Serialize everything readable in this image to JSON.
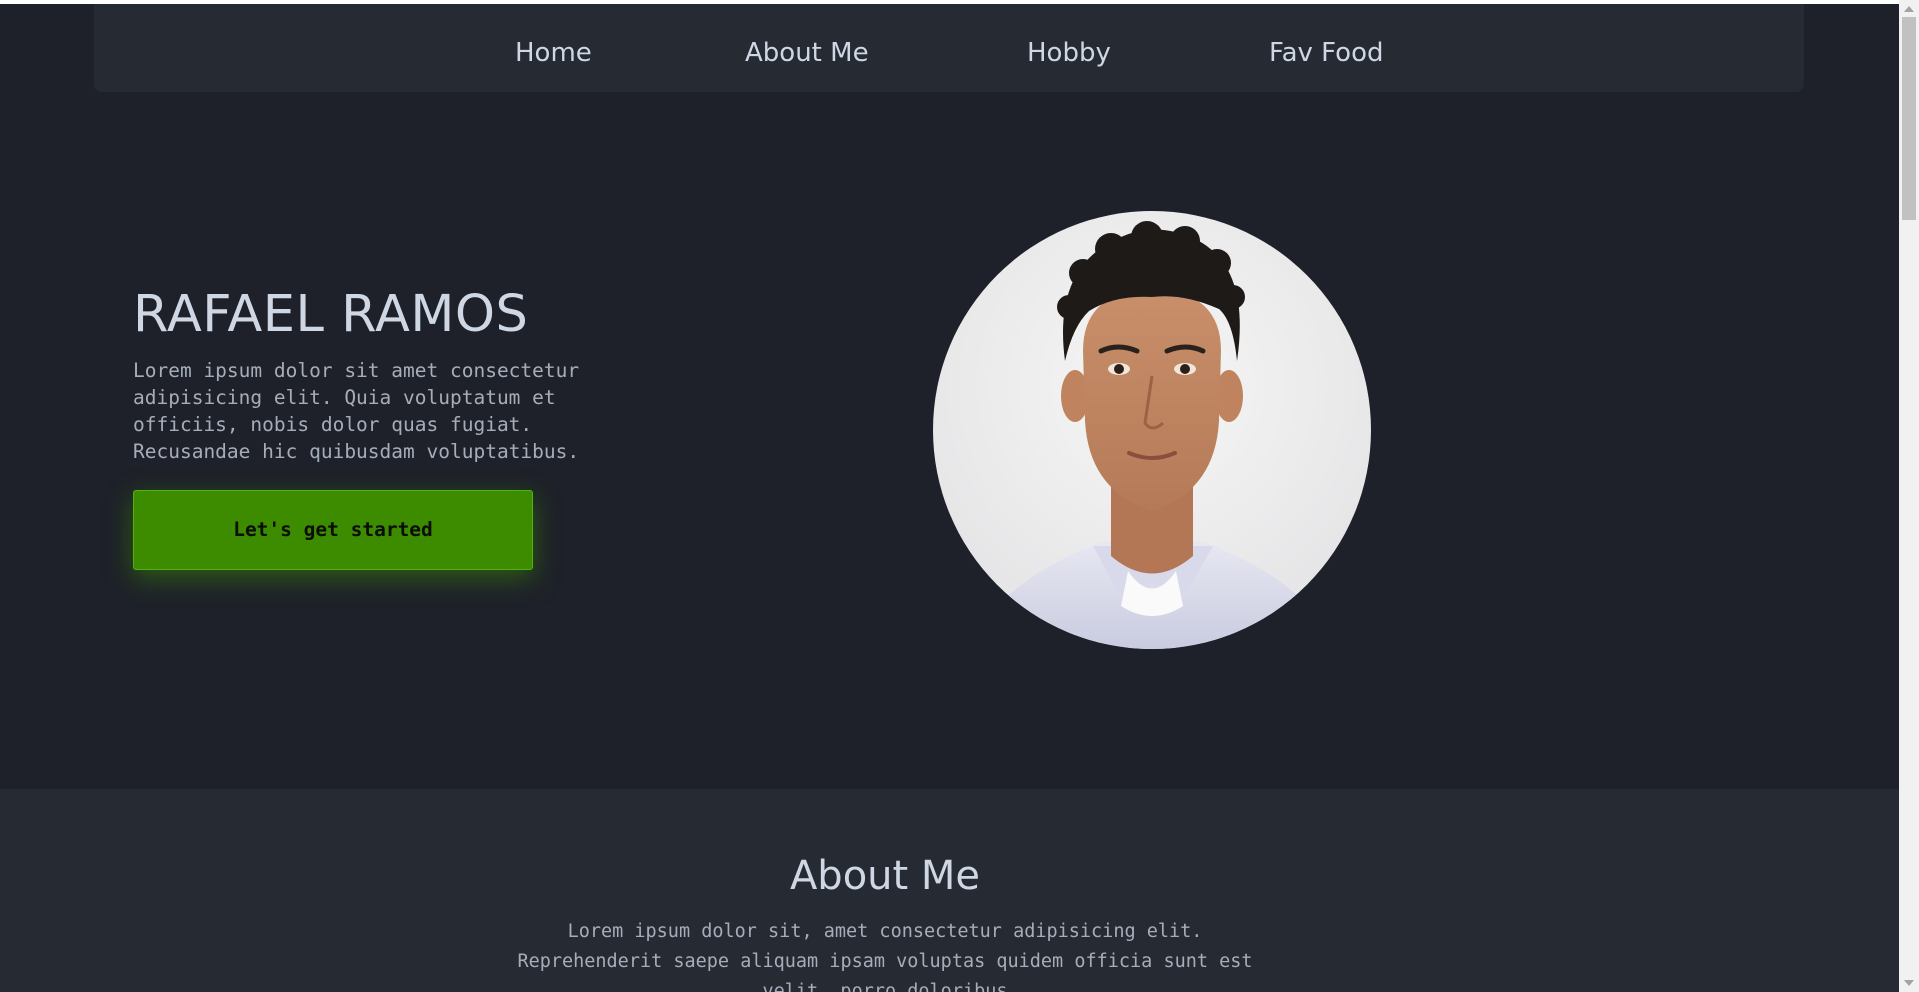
{
  "nav": {
    "items": [
      {
        "label": "Home"
      },
      {
        "label": "About Me"
      },
      {
        "label": "Hobby"
      },
      {
        "label": "Fav Food"
      }
    ]
  },
  "hero": {
    "title": "RAFAEL RAMOS",
    "text": "Lorem ipsum dolor sit amet consectetur adipisicing elit. Quia voluptatum et officiis, nobis dolor quas fugiat. Recusandae hic quibusdam voluptatibus.",
    "cta_label": "Let's get started"
  },
  "about": {
    "title": "About Me",
    "text": "Lorem ipsum dolor sit, amet consectetur adipisicing elit. Reprehenderit saepe aliquam ipsam voluptas quidem officia sunt est velit, porro doloribus"
  },
  "colors": {
    "page_bg": "#1e2129",
    "panel_bg": "#262b33",
    "text_primary": "#cfd6e4",
    "text_muted": "#a6adba",
    "accent_green": "#3d8c00"
  },
  "icons": {
    "scroll_up": "scroll-up-arrow-icon",
    "scroll_down": "scroll-down-arrow-icon"
  }
}
